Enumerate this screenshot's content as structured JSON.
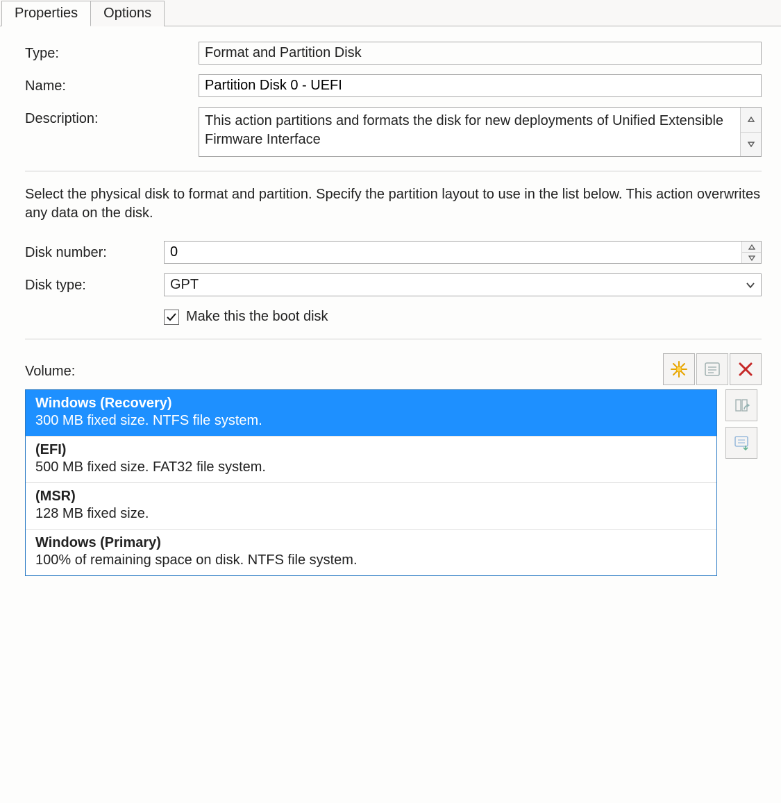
{
  "tabs": {
    "properties": "Properties",
    "options": "Options",
    "active": "properties"
  },
  "fields": {
    "type_label": "Type:",
    "type_value": "Format and Partition Disk",
    "name_label": "Name:",
    "name_value": "Partition Disk 0 - UEFI",
    "description_label": "Description:",
    "description_value": "This action partitions and formats the disk for new deployments of Unified Extensible Firmware Interface"
  },
  "instruction": "Select the physical disk to format and partition. Specify the partition layout to use in the list below. This action overwrites any data on the disk.",
  "disk": {
    "number_label": "Disk number:",
    "number_value": "0",
    "type_label": "Disk type:",
    "type_value": "GPT",
    "boot_label": "Make this the boot disk",
    "boot_checked": true
  },
  "volume": {
    "label": "Volume:",
    "items": [
      {
        "name": "Windows (Recovery)",
        "sub": "300 MB fixed size. NTFS file system.",
        "selected": true
      },
      {
        "name": "(EFI)",
        "sub": "500 MB fixed size. FAT32 file system.",
        "selected": false
      },
      {
        "name": "(MSR)",
        "sub": "128 MB fixed size.",
        "selected": false
      },
      {
        "name": "Windows (Primary)",
        "sub": "100% of remaining space on disk. NTFS file system.",
        "selected": false
      }
    ]
  },
  "icons": {
    "new": "new-icon",
    "properties": "properties-icon",
    "delete": "delete-icon",
    "move_up": "move-up-icon",
    "move_down": "move-down-icon"
  }
}
